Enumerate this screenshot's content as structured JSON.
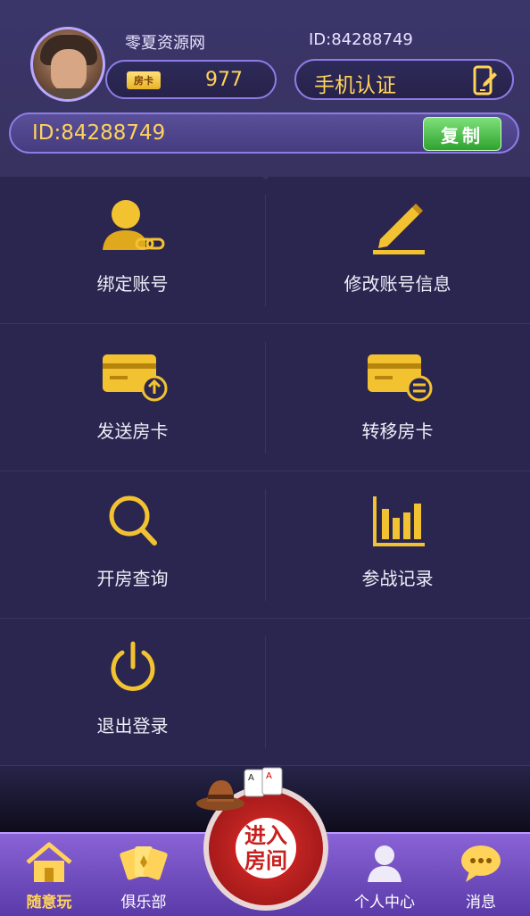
{
  "profile": {
    "nickname": "零夏资源网",
    "id_label": "ID:84288749",
    "card_badge": "房卡",
    "card_count": "977",
    "phone_verify_label": "手机认证",
    "id_bar_text": "ID:84288749",
    "copy_label": "复制"
  },
  "menu": {
    "items": [
      {
        "label": "绑定账号",
        "icon": "bind-account-icon"
      },
      {
        "label": "修改账号信息",
        "icon": "edit-pencil-icon"
      },
      {
        "label": "发送房卡",
        "icon": "send-card-icon"
      },
      {
        "label": "转移房卡",
        "icon": "transfer-card-icon"
      },
      {
        "label": "开房查询",
        "icon": "search-icon"
      },
      {
        "label": "参战记录",
        "icon": "bar-chart-icon"
      },
      {
        "label": "退出登录",
        "icon": "power-icon"
      }
    ]
  },
  "nav": {
    "items": [
      {
        "label": "随意玩",
        "icon": "home-icon",
        "active": true
      },
      {
        "label": "俱乐部",
        "icon": "cards-icon"
      },
      {
        "label": "个人中心",
        "icon": "person-icon"
      },
      {
        "label": "消息",
        "icon": "chat-bubble-icon"
      }
    ],
    "enter_room_line1": "进入",
    "enter_room_line2": "房间"
  },
  "colors": {
    "background": "#2a2650",
    "gold": "#ffd35a",
    "nav_purple": "#7b55c8",
    "copy_green": "#3fb33c"
  }
}
